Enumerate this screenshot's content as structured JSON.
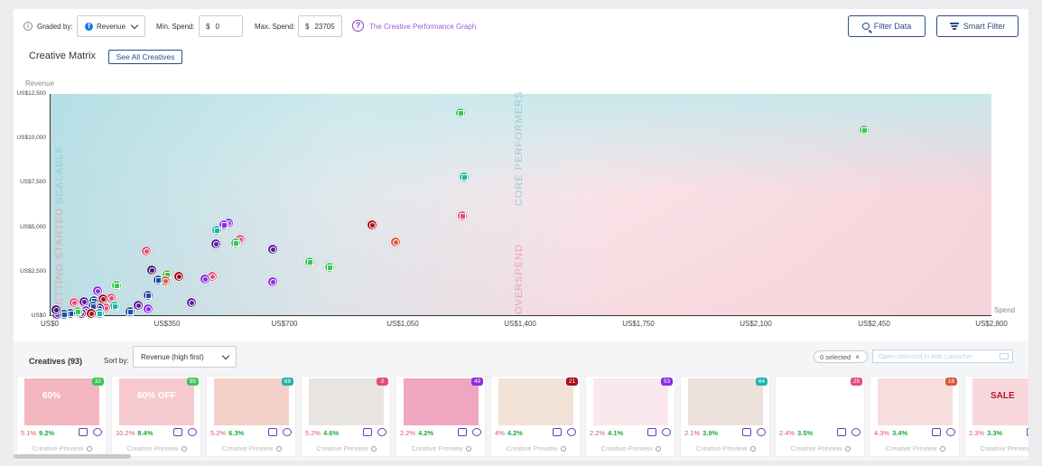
{
  "toolbar": {
    "graded_by_label": "Graded by:",
    "graded_by_value": "Revenue",
    "min_spend_label": "Min. Spend:",
    "min_spend_currency": "$",
    "min_spend_value": "0",
    "max_spend_label": "Max. Spend:",
    "max_spend_currency": "$",
    "max_spend_value": "23705",
    "help_link": "The Creative Performance Graph",
    "filter_data": "Filter Data",
    "smart_filter": "Smart Filter"
  },
  "matrix": {
    "title": "Creative Matrix",
    "see_all": "See All Creatives",
    "y_axis_label": "Revenue",
    "x_axis_label": "Spend",
    "y_ticks": [
      "US$12,500",
      "US$10,000",
      "US$7,500",
      "US$5,000",
      "US$2,500",
      "US$0"
    ],
    "x_ticks": [
      "US$0",
      "US$350",
      "US$700",
      "US$1,050",
      "US$1,400",
      "US$1,750",
      "US$2,100",
      "US$2,450",
      "US$2,800"
    ],
    "quadrants": {
      "scalable": "SCALABLE",
      "getting_started": "GETTING STARTED",
      "core_performers": "CORE PERFORMERS",
      "overspend": "OVERSPEND"
    }
  },
  "chart_data": {
    "type": "scatter",
    "xlabel": "Spend",
    "ylabel": "Revenue",
    "xlim": [
      0,
      2800
    ],
    "ylim": [
      0,
      12500
    ],
    "points": [
      {
        "x": 1220,
        "y": 11450,
        "color": "#3fc45a",
        "kind": "image"
      },
      {
        "x": 2420,
        "y": 10450,
        "color": "#3fc45a",
        "kind": "image"
      },
      {
        "x": 1230,
        "y": 7800,
        "color": "#1fb3a8",
        "kind": "image"
      },
      {
        "x": 1225,
        "y": 5650,
        "color": "#e0507a",
        "kind": "image"
      },
      {
        "x": 955,
        "y": 5150,
        "color": "#a80d1a",
        "kind": "video"
      },
      {
        "x": 1025,
        "y": 4150,
        "color": "#d8583a",
        "kind": "video"
      },
      {
        "x": 530,
        "y": 5250,
        "color": "#8a2be2",
        "kind": "video"
      },
      {
        "x": 515,
        "y": 5150,
        "color": "#8a2be2",
        "kind": "image"
      },
      {
        "x": 495,
        "y": 4850,
        "color": "#1fb3a8",
        "kind": "image"
      },
      {
        "x": 565,
        "y": 4300,
        "color": "#e0507a",
        "kind": "video"
      },
      {
        "x": 550,
        "y": 4100,
        "color": "#3fc45a",
        "kind": "image"
      },
      {
        "x": 490,
        "y": 4050,
        "color": "#5a1e9a",
        "kind": "video"
      },
      {
        "x": 660,
        "y": 3750,
        "color": "#5a1e9a",
        "kind": "video"
      },
      {
        "x": 285,
        "y": 3650,
        "color": "#e0507a",
        "kind": "video"
      },
      {
        "x": 770,
        "y": 3050,
        "color": "#3fc45a",
        "kind": "image"
      },
      {
        "x": 830,
        "y": 2750,
        "color": "#3fc45a",
        "kind": "image"
      },
      {
        "x": 300,
        "y": 2600,
        "color": "#3a1570",
        "kind": "video"
      },
      {
        "x": 345,
        "y": 2350,
        "color": "#3fc45a",
        "kind": "image"
      },
      {
        "x": 380,
        "y": 2250,
        "color": "#a80d1a",
        "kind": "video"
      },
      {
        "x": 480,
        "y": 2250,
        "color": "#e0507a",
        "kind": "video"
      },
      {
        "x": 460,
        "y": 2100,
        "color": "#8a2be2",
        "kind": "video"
      },
      {
        "x": 660,
        "y": 1950,
        "color": "#8a2be2",
        "kind": "video"
      },
      {
        "x": 340,
        "y": 2000,
        "color": "#d8583a",
        "kind": "video"
      },
      {
        "x": 320,
        "y": 2050,
        "color": "#1e4fa0",
        "kind": "image"
      },
      {
        "x": 195,
        "y": 1750,
        "color": "#3fc45a",
        "kind": "image"
      },
      {
        "x": 140,
        "y": 1400,
        "color": "#8a2be2",
        "kind": "video"
      },
      {
        "x": 290,
        "y": 1150,
        "color": "#1e4fa0",
        "kind": "image"
      },
      {
        "x": 420,
        "y": 750,
        "color": "#5a1e9a",
        "kind": "video"
      },
      {
        "x": 260,
        "y": 600,
        "color": "#5a1e9a",
        "kind": "video"
      },
      {
        "x": 290,
        "y": 400,
        "color": "#8a2be2",
        "kind": "video"
      },
      {
        "x": 235,
        "y": 250,
        "color": "#1e4fa0",
        "kind": "image"
      },
      {
        "x": 180,
        "y": 1000,
        "color": "#e0507a",
        "kind": "video"
      },
      {
        "x": 155,
        "y": 950,
        "color": "#a80d1a",
        "kind": "video"
      },
      {
        "x": 130,
        "y": 850,
        "color": "#1e4fa0",
        "kind": "image"
      },
      {
        "x": 100,
        "y": 800,
        "color": "#5a1e9a",
        "kind": "video"
      },
      {
        "x": 70,
        "y": 750,
        "color": "#e0507a",
        "kind": "video"
      },
      {
        "x": 190,
        "y": 550,
        "color": "#1fb3a8",
        "kind": "image"
      },
      {
        "x": 165,
        "y": 450,
        "color": "#e0507a",
        "kind": "video"
      },
      {
        "x": 145,
        "y": 450,
        "color": "#5a1e9a",
        "kind": "video"
      },
      {
        "x": 125,
        "y": 550,
        "color": "#1e4fa0",
        "kind": "image"
      },
      {
        "x": 105,
        "y": 300,
        "color": "#8a2be2",
        "kind": "video"
      },
      {
        "x": 145,
        "y": 150,
        "color": "#1fb3a8",
        "kind": "image"
      },
      {
        "x": 120,
        "y": 150,
        "color": "#a80d1a",
        "kind": "video"
      },
      {
        "x": 90,
        "y": 150,
        "color": "#5a1e9a",
        "kind": "video"
      },
      {
        "x": 80,
        "y": 250,
        "color": "#3fc45a",
        "kind": "image"
      },
      {
        "x": 60,
        "y": 150,
        "color": "#1e4fa0",
        "kind": "image"
      },
      {
        "x": 40,
        "y": 100,
        "color": "#1e4fa0",
        "kind": "image"
      },
      {
        "x": 20,
        "y": 80,
        "color": "#5a1e9a",
        "kind": "video"
      },
      {
        "x": 15,
        "y": 350,
        "color": "#3a1570",
        "kind": "video"
      }
    ]
  },
  "creatives": {
    "title": "Creatives (93)",
    "sort_label": "Sort by:",
    "sort_value": "Revenue (high first)",
    "selected": "0 selected",
    "open_launcher": "Open selected in Ads Launcher",
    "preview_label": "Creative Preview",
    "cards": [
      {
        "badge": "32",
        "badge_color": "#3fc45a",
        "m1": "5.1%",
        "m2": "9.2%",
        "thumb": "#f4b6be",
        "thumb_text": "60%"
      },
      {
        "badge": "95",
        "badge_color": "#3fc45a",
        "m1": "10.2%",
        "m2": "8.4%",
        "thumb": "#f6c9cf",
        "thumb_text": "60% OFF"
      },
      {
        "badge": "68",
        "badge_color": "#1fb3a8",
        "m1": "5.2%",
        "m2": "6.3%",
        "thumb": "#f2d0c8",
        "thumb_text": ""
      },
      {
        "badge": "2",
        "badge_color": "#e0507a",
        "m1": "5.2%",
        "m2": "4.6%",
        "thumb": "#e8e4e2",
        "thumb_text": ""
      },
      {
        "badge": "49",
        "badge_color": "#8a2be2",
        "m1": "2.2%",
        "m2": "4.2%",
        "thumb": "#f0a6c0",
        "thumb_text": ""
      },
      {
        "badge": "21",
        "badge_color": "#a80d1a",
        "m1": "4%",
        "m2": "4.2%",
        "thumb": "#f2e2d8",
        "thumb_text": ""
      },
      {
        "badge": "53",
        "badge_color": "#8a2be2",
        "m1": "2.2%",
        "m2": "4.1%",
        "thumb": "#fbe8ec",
        "thumb_text": ""
      },
      {
        "badge": "64",
        "badge_color": "#1fb3a8",
        "m1": "2.1%",
        "m2": "3.9%",
        "thumb": "#ece0da",
        "thumb_text": ""
      },
      {
        "badge": "25",
        "badge_color": "#e0507a",
        "m1": "2.4%",
        "m2": "3.5%",
        "thumb": "#ffffff",
        "thumb_text": ""
      },
      {
        "badge": "18",
        "badge_color": "#d8583a",
        "m1": "4.3%",
        "m2": "3.4%",
        "thumb": "#f6dede",
        "thumb_text": ""
      },
      {
        "badge": "",
        "badge_color": "#ffffff",
        "m1": "2.3%",
        "m2": "3.3%",
        "thumb": "#f8d8dc",
        "thumb_text": "SALE"
      }
    ]
  }
}
